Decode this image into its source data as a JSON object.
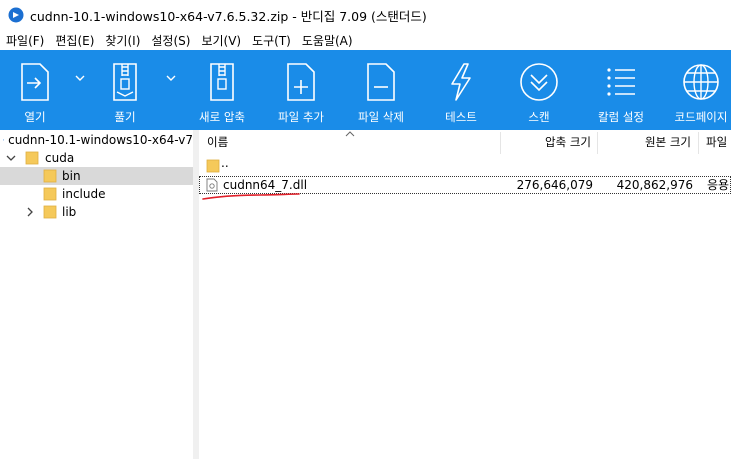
{
  "window": {
    "title": "cudnn-10.1-windows10-x64-v7.6.5.32.zip - 반디집 7.09 (스탠더드)"
  },
  "menu": [
    "파일(F)",
    "편집(E)",
    "찾기(I)",
    "설정(S)",
    "보기(V)",
    "도구(T)",
    "도움말(A)"
  ],
  "toolbar": {
    "open": "열기",
    "extract": "풀기",
    "new_archive": "새로 압축",
    "add_file": "파일 추가",
    "delete_file": "파일 삭제",
    "test": "테스트",
    "scan": "스캔",
    "settings": "칼럼 설정",
    "codepage": "코드페이지"
  },
  "tree": {
    "root": "cudnn-10.1-windows10-x64-v7",
    "cuda": "cuda",
    "bin": "bin",
    "include": "include",
    "lib": "lib"
  },
  "columns": {
    "name": "이름",
    "packed": "압축 크기",
    "original": "원본 크기",
    "type": "파일"
  },
  "files": [
    {
      "name": "..",
      "packed": "",
      "original": "",
      "type": ""
    },
    {
      "name": "cudnn64_7.dll",
      "packed": "276,646,079",
      "original": "420,862,976",
      "type": "응용"
    }
  ],
  "colors": {
    "toolbar_bg": "#1a8ce8",
    "folder": "#f5c95a",
    "selection": "#d9d9d9",
    "annotation_red": "#e0202a",
    "app_icon": "#1b6fd1"
  }
}
